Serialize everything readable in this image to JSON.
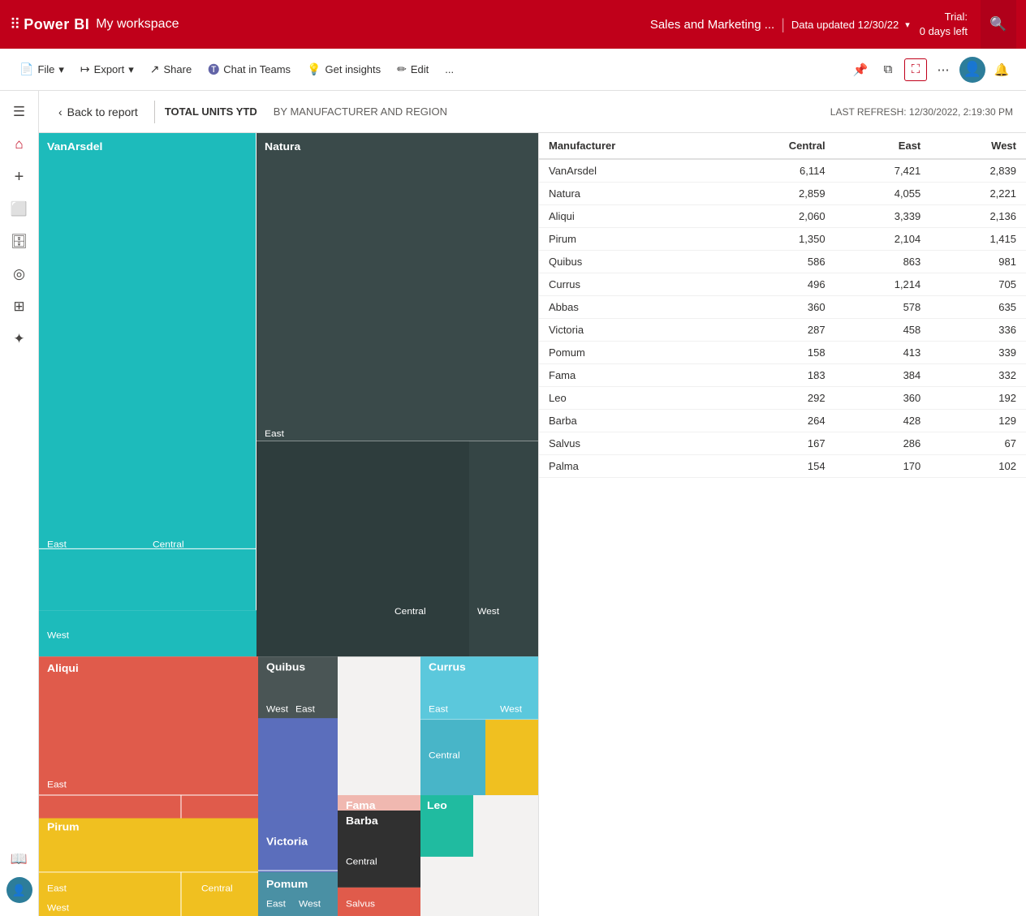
{
  "topbar": {
    "brand": "Power BI",
    "workspace": "My workspace",
    "report_title": "Sales and Marketing ...",
    "separator": "|",
    "data_updated": "Data updated 12/30/22",
    "trial_line1": "Trial:",
    "trial_line2": "0 days left"
  },
  "toolbar": {
    "file_label": "File",
    "export_label": "Export",
    "share_label": "Share",
    "chat_label": "Chat in Teams",
    "insights_label": "Get insights",
    "edit_label": "Edit",
    "more_label": "..."
  },
  "secondary_toolbar": {
    "back_label": "Back to report",
    "tab1": "TOTAL UNITS YTD",
    "tab2": "BY MANUFACTURER AND REGION",
    "last_refresh": "LAST REFRESH: 12/30/2022, 2:19:30 PM"
  },
  "table": {
    "headers": [
      "Manufacturer",
      "Central",
      "East",
      "West"
    ],
    "rows": [
      [
        "VanArsdel",
        "6,114",
        "7,421",
        "2,839"
      ],
      [
        "Natura",
        "2,859",
        "4,055",
        "2,221"
      ],
      [
        "Aliqui",
        "2,060",
        "3,339",
        "2,136"
      ],
      [
        "Pirum",
        "1,350",
        "2,104",
        "1,415"
      ],
      [
        "Quibus",
        "586",
        "863",
        "981"
      ],
      [
        "Currus",
        "496",
        "1,214",
        "705"
      ],
      [
        "Abbas",
        "360",
        "578",
        "635"
      ],
      [
        "Victoria",
        "287",
        "458",
        "336"
      ],
      [
        "Pomum",
        "158",
        "413",
        "339"
      ],
      [
        "Fama",
        "183",
        "384",
        "332"
      ],
      [
        "Leo",
        "292",
        "360",
        "192"
      ],
      [
        "Barba",
        "264",
        "428",
        "129"
      ],
      [
        "Salvus",
        "167",
        "286",
        "67"
      ],
      [
        "Palma",
        "154",
        "170",
        "102"
      ]
    ]
  },
  "sidebar": {
    "items": [
      {
        "name": "hamburger",
        "icon": "☰"
      },
      {
        "name": "home",
        "icon": "⌂"
      },
      {
        "name": "create",
        "icon": "+"
      },
      {
        "name": "browse",
        "icon": "⬜"
      },
      {
        "name": "data-hub",
        "icon": "🗄"
      },
      {
        "name": "goals",
        "icon": "◎"
      },
      {
        "name": "apps",
        "icon": "⊞"
      },
      {
        "name": "learn",
        "icon": "✦"
      },
      {
        "name": "workspaces",
        "icon": "📖"
      }
    ]
  }
}
